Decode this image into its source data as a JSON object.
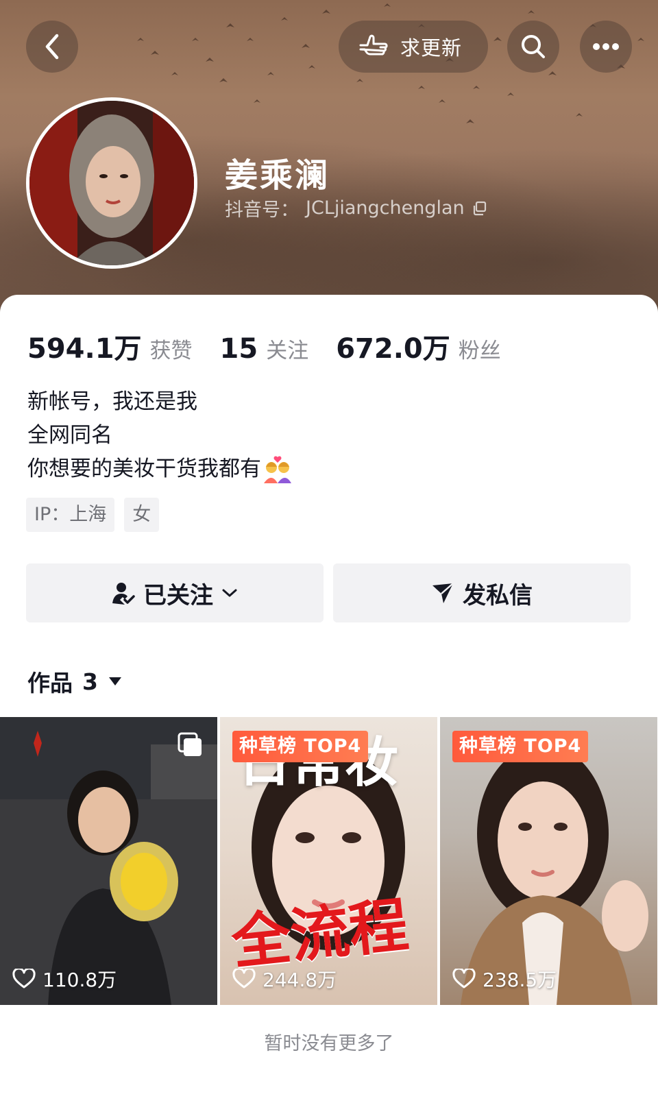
{
  "header": {
    "update_button_label": "求更新",
    "name": "姜乘澜",
    "douyin_id_label": "抖音号：",
    "douyin_id": "JCLjiangchenglan"
  },
  "stats": [
    {
      "value": "594.1万",
      "label": "获赞"
    },
    {
      "value": "15",
      "label": "关注"
    },
    {
      "value": "672.0万",
      "label": "粉丝"
    }
  ],
  "bio": {
    "lines": [
      "新帐号，我还是我",
      "全网同名",
      "你想要的美妆干货我都有"
    ]
  },
  "tags": [
    "IP：上海",
    "女"
  ],
  "actions": {
    "follow_label": "已关注",
    "message_label": "发私信"
  },
  "works": {
    "title": "作品",
    "count": "3",
    "items": [
      {
        "likes": "110.8万",
        "badge": "",
        "overlay": ""
      },
      {
        "likes": "244.8万",
        "badge": "种草榜 TOP4",
        "overlay_top": "日常妆",
        "overlay_bottom": "全流程"
      },
      {
        "likes": "238.5万",
        "badge": "种草榜 TOP4",
        "overlay": ""
      }
    ]
  },
  "footer": {
    "end_text": "暂时没有更多了"
  },
  "colors": {
    "banner": "#9a7660",
    "badge": "#ff5a3c",
    "text_primary": "#161823",
    "text_secondary": "#8a8b91",
    "button_bg": "#f2f2f4"
  }
}
